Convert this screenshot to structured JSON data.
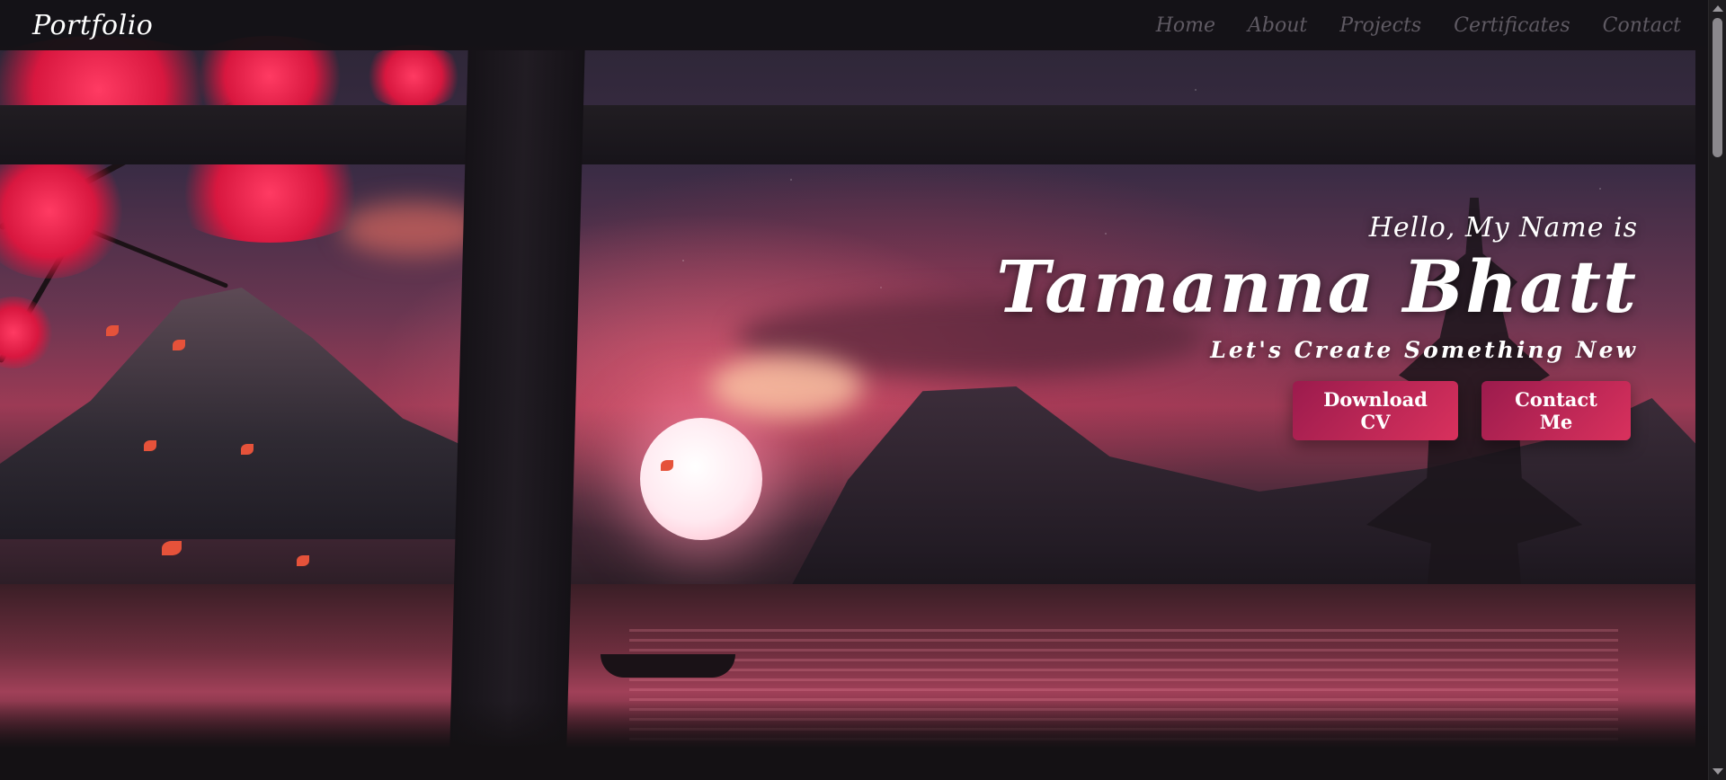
{
  "navbar": {
    "brand": "Portfolio",
    "links": [
      {
        "label": "Home"
      },
      {
        "label": "About"
      },
      {
        "label": "Projects"
      },
      {
        "label": "Certificates"
      },
      {
        "label": "Contact"
      }
    ]
  },
  "hero": {
    "greeting": "Hello, My Name is",
    "name": "Tamanna Bhatt",
    "tagline": "Let's Create Something New",
    "buttons": {
      "download_cv": "Download CV",
      "contact_me": "Contact Me"
    }
  },
  "colors": {
    "accent_start": "#9b1b4d",
    "accent_end": "#d9315d",
    "nav_background": "#141216",
    "nav_link": "#5f5a63",
    "text": "#ffffff"
  },
  "icons": {
    "scroll_up": "chevron-up-icon",
    "scroll_down": "chevron-down-icon"
  }
}
